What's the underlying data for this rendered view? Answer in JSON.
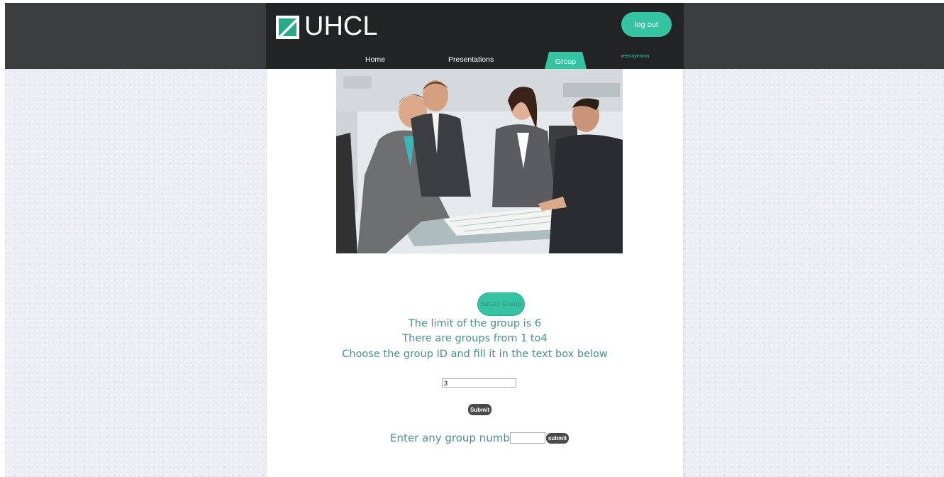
{
  "header": {
    "brand": "UHCL",
    "logout_label": "log out",
    "username": "veenayeruva",
    "nav": [
      {
        "label": "Home"
      },
      {
        "label": "Presentations"
      },
      {
        "label": "Group",
        "active": true
      }
    ],
    "accent_color": "#35c4a1"
  },
  "hero": {
    "image_icon": "meeting-photo"
  },
  "group_form": {
    "select_label": "Select Group",
    "info_lines": [
      "The limit of the group is 6",
      "There are groups from 1 to4",
      "Choose the group ID and fill it in the text box below"
    ],
    "group_id_value": "3",
    "submit_label": "Submit"
  },
  "search_form": {
    "label": "Enter any group number",
    "value": "",
    "submit_label": "submit"
  }
}
